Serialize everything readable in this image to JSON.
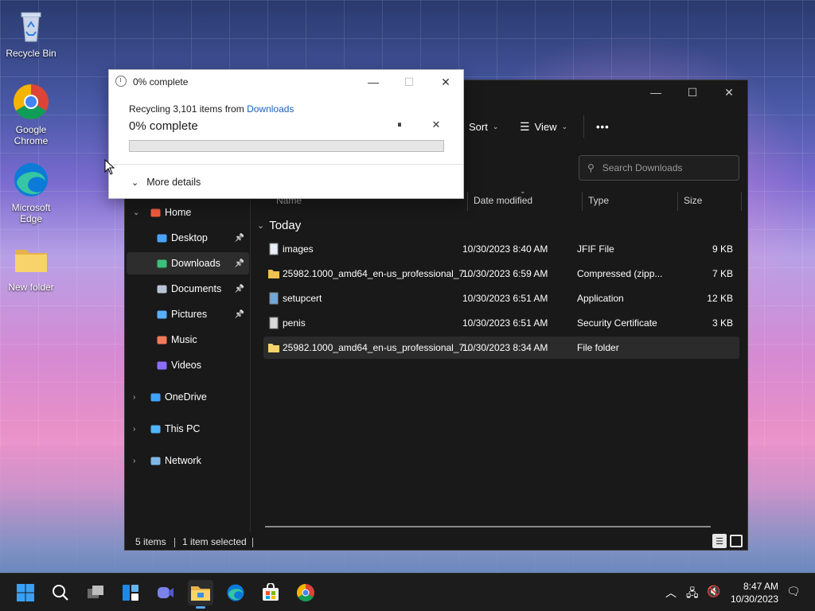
{
  "desktop": {
    "icons": [
      {
        "label": "Recycle Bin",
        "icon": "recycle-bin-icon"
      },
      {
        "label": "Google Chrome",
        "icon": "chrome-icon"
      },
      {
        "label": "Microsoft Edge",
        "icon": "edge-icon"
      },
      {
        "label": "New folder",
        "icon": "folder-icon"
      }
    ]
  },
  "progress_dialog": {
    "title": "0% complete",
    "desc_prefix": "Recycling 3,101 items from ",
    "desc_link": "Downloads",
    "percent_text": "0% complete",
    "progress": 0,
    "more_details": "More details",
    "controls": {
      "minimize": "—",
      "maximize": "☐",
      "close": "✕",
      "pause": "⏸",
      "cancel": "✕"
    }
  },
  "explorer": {
    "toolbar": {
      "sort": "Sort",
      "view": "View",
      "more": "•••"
    },
    "search": {
      "placeholder": "Search Downloads"
    },
    "nav": [
      {
        "label": "Home",
        "icon": "home-icon",
        "expander": "⌄"
      },
      {
        "label": "Desktop",
        "icon": "desktop-icon",
        "pin": true
      },
      {
        "label": "Downloads",
        "icon": "downloads-icon",
        "pin": true,
        "selected": true
      },
      {
        "label": "Documents",
        "icon": "documents-icon",
        "pin": true
      },
      {
        "label": "Pictures",
        "icon": "pictures-icon",
        "pin": true
      },
      {
        "label": "Music",
        "icon": "music-icon"
      },
      {
        "label": "Videos",
        "icon": "videos-icon"
      },
      {
        "label": "OneDrive",
        "icon": "onedrive-icon",
        "expander": "›"
      },
      {
        "label": "This PC",
        "icon": "this-pc-icon",
        "expander": "›"
      },
      {
        "label": "Network",
        "icon": "network-icon",
        "expander": "›"
      }
    ],
    "columns": {
      "name": "Name",
      "date": "Date modified",
      "type": "Type",
      "size": "Size"
    },
    "group": "Today",
    "files": [
      {
        "name": "images",
        "date": "10/30/2023 8:40 AM",
        "type": "JFIF File",
        "size": "9 KB",
        "icon": "image-file-icon"
      },
      {
        "name": "25982.1000_amd64_en-us_professional_7...",
        "date": "10/30/2023 6:59 AM",
        "type": "Compressed (zipp...",
        "size": "7 KB",
        "icon": "zip-folder-icon"
      },
      {
        "name": "setupcert",
        "date": "10/30/2023 6:51 AM",
        "type": "Application",
        "size": "12 KB",
        "icon": "application-icon"
      },
      {
        "name": "penis",
        "date": "10/30/2023 6:51 AM",
        "type": "Security Certificate",
        "size": "3 KB",
        "icon": "certificate-icon"
      },
      {
        "name": "25982.1000_amd64_en-us_professional_7...",
        "date": "10/30/2023 8:34 AM",
        "type": "File folder",
        "size": "",
        "icon": "folder-icon",
        "selected": true
      }
    ],
    "status": {
      "items": "5 items",
      "selected": "1 item selected"
    }
  },
  "taskbar": {
    "apps": [
      "start-icon",
      "search-icon",
      "task-view-icon",
      "widgets-icon",
      "chat-icon",
      "file-explorer-icon",
      "edge-icon",
      "store-icon",
      "chrome-icon"
    ],
    "time": "8:47 AM",
    "date": "10/30/2023"
  },
  "colors": {
    "accent": "#58a6ff",
    "progress": "#06b025",
    "link": "#1f5fbf"
  }
}
